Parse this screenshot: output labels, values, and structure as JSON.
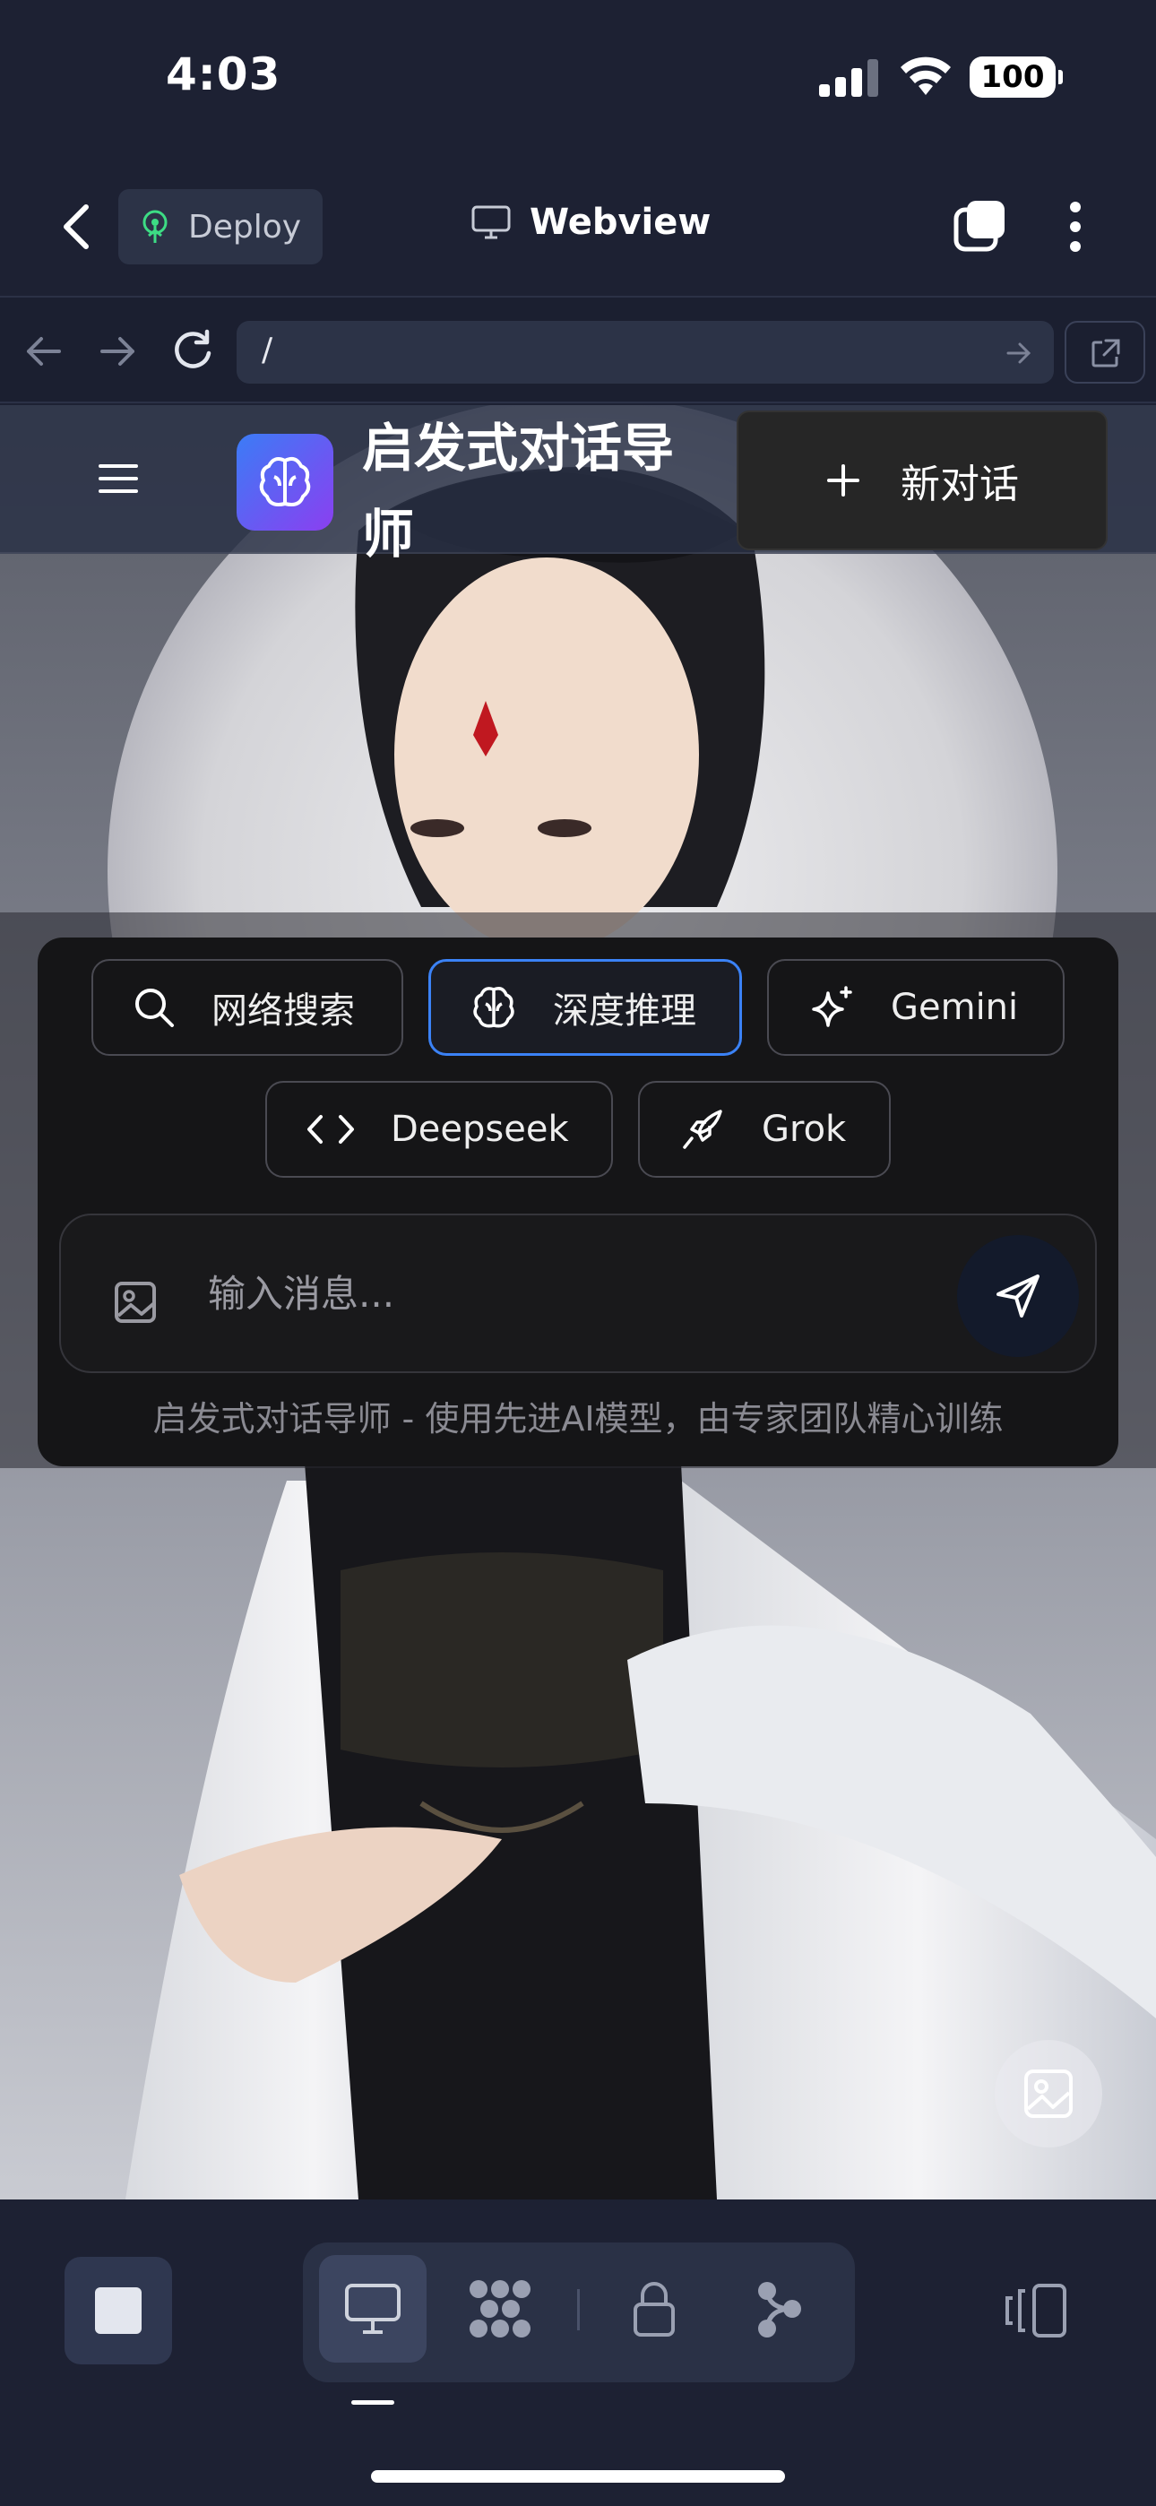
{
  "status_bar": {
    "time": "4:03",
    "battery": "100"
  },
  "header": {
    "deploy_label": "Deploy",
    "title": "Webview"
  },
  "browser": {
    "url": "/"
  },
  "site": {
    "title": "启发式对话导师",
    "new_chat_label": "新对话",
    "tools": [
      {
        "label": "网络搜索",
        "icon": "search-icon"
      },
      {
        "label": "深度推理",
        "icon": "brain-icon",
        "active": true
      },
      {
        "label": "Gemini",
        "icon": "sparkle-icon"
      },
      {
        "label": "Deepseek",
        "icon": "code-icon"
      },
      {
        "label": "Grok",
        "icon": "rocket-icon"
      }
    ],
    "input_placeholder": "输入消息...",
    "footer": "启发式对话导师 - 使用先进AI模型，由专家团队精心训练"
  },
  "colors": {
    "app_bg": "#1d2133",
    "accent_blue": "#3b82f6",
    "logo_gradient_start": "#3b7cf6",
    "logo_gradient_end": "#8b3ff0",
    "deploy_icon": "#3ddc84"
  },
  "toolbar": {
    "items": [
      "stop-icon",
      "monitor-icon",
      "grid-icon",
      "lock-icon",
      "branch-icon",
      "layout-icon"
    ]
  }
}
